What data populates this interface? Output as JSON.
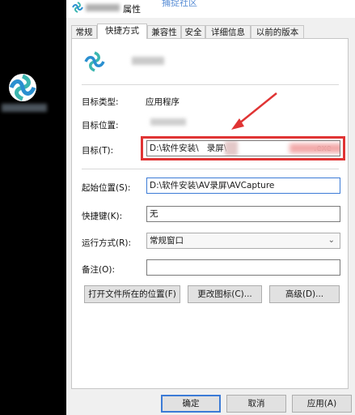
{
  "window": {
    "title_suffix": "属性",
    "header_link": "捕捉社区"
  },
  "tabs": [
    {
      "label": "常规"
    },
    {
      "label": "快捷方式",
      "active": true
    },
    {
      "label": "兼容性"
    },
    {
      "label": "安全"
    },
    {
      "label": "详细信息"
    },
    {
      "label": "以前的版本"
    }
  ],
  "properties": {
    "target_type_label": "目标类型:",
    "target_type_value": "应用程序",
    "target_location_label": "目标位置:",
    "target_label": "目标(T):",
    "target_value_prefix": "D:\\软件安装\\",
    "target_value_mid": "录屏\\",
    "target_value_suffix": ".exe",
    "start_in_label": "起始位置(S):",
    "start_in_value": "D:\\软件安装\\AV录屏\\AVCapture",
    "shortcut_key_label": "快捷键(K):",
    "shortcut_key_value": "无",
    "run_label": "运行方式(R):",
    "run_value": "常规窗口",
    "comment_label": "备注(O):",
    "comment_value": ""
  },
  "actions": {
    "open_location": "打开文件所在的位置(F)",
    "change_icon": "更改图标(C)...",
    "advanced": "高级(D)..."
  },
  "footer": {
    "ok": "确定",
    "cancel": "取消",
    "apply": "应用(A)"
  },
  "colors": {
    "highlight_box": "#e03434",
    "focus_border": "#3c7bd6"
  },
  "icons": {
    "app": "app-logo-icon",
    "dropdown": "chevron-down-icon"
  }
}
